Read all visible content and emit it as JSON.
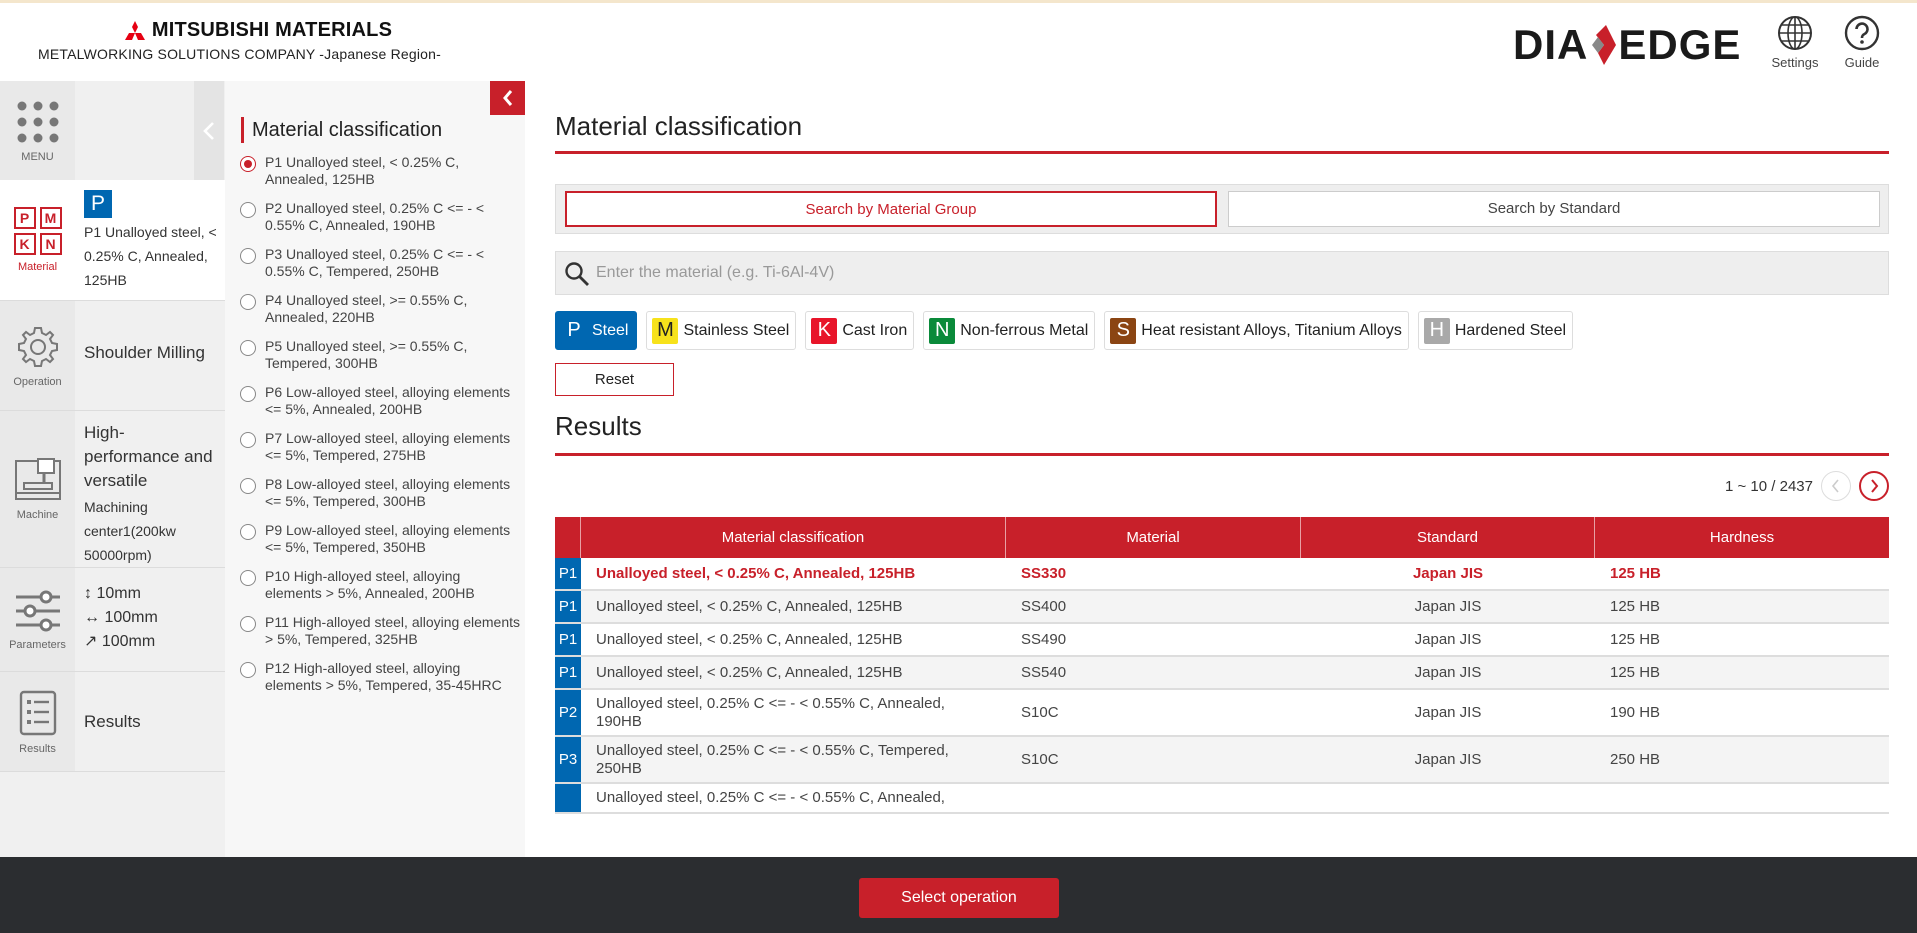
{
  "header": {
    "brand_name": "MITSUBISHI MATERIALS",
    "brand_sub": "METALWORKING SOLUTIONS COMPANY -Japanese Region-",
    "logo_left": "DIA",
    "logo_right": "EDGE",
    "settings_label": "Settings",
    "guide_label": "Guide"
  },
  "sidebar": {
    "menu_label": "MENU",
    "material": {
      "label": "Material",
      "badge": "P",
      "text": "P1 Unalloyed steel, < 0.25% C, Annealed, 125HB"
    },
    "operation": {
      "label": "Operation",
      "text": "Shoulder Milling"
    },
    "machine": {
      "label": "Machine",
      "title": "High-performance and versatile",
      "text": "Machining center1(200kw 50000rpm)"
    },
    "parameters": {
      "label": "Parameters",
      "p1": "↕ 10mm",
      "p2": "↔ 100mm",
      "p3": "↗ 100mm"
    },
    "results": {
      "label": "Results",
      "text": "Results"
    },
    "icon_letters": [
      "P",
      "M",
      "K",
      "N"
    ]
  },
  "material_panel": {
    "title": "Material classification",
    "items": [
      {
        "label": "P1 Unalloyed steel, < 0.25% C, Annealed, 125HB",
        "selected": true
      },
      {
        "label": "P2 Unalloyed steel, 0.25% C <= - < 0.55% C, Annealed, 190HB",
        "selected": false
      },
      {
        "label": "P3 Unalloyed steel, 0.25% C <= - < 0.55% C, Tempered, 250HB",
        "selected": false
      },
      {
        "label": "P4 Unalloyed steel, >= 0.55% C, Annealed, 220HB",
        "selected": false
      },
      {
        "label": "P5 Unalloyed steel, >= 0.55% C, Tempered, 300HB",
        "selected": false
      },
      {
        "label": "P6 Low-alloyed steel, alloying elements <= 5%, Annealed, 200HB",
        "selected": false
      },
      {
        "label": "P7 Low-alloyed steel, alloying elements <= 5%, Tempered, 275HB",
        "selected": false
      },
      {
        "label": "P8 Low-alloyed steel, alloying elements <= 5%, Tempered, 300HB",
        "selected": false
      },
      {
        "label": "P9 Low-alloyed steel, alloying elements <= 5%, Tempered, 350HB",
        "selected": false
      },
      {
        "label": "P10 High-alloyed steel, alloying elements > 5%, Annealed, 200HB",
        "selected": false
      },
      {
        "label": "P11 High-alloyed steel, alloying elements > 5%, Tempered, 325HB",
        "selected": false
      },
      {
        "label": "P12 High-alloyed steel, alloying elements > 5%, Tempered, 35-45HRC",
        "selected": false
      }
    ]
  },
  "main": {
    "title": "Material classification",
    "tab_group": "Search by Material Group",
    "tab_standard": "Search by Standard",
    "search_placeholder": "Enter the material (e.g. Ti-6Al-4V)",
    "chips": [
      {
        "code": "P",
        "label": "Steel",
        "color": "#0067b1",
        "text_color": "#ffffff",
        "active": true
      },
      {
        "code": "M",
        "label": "Stainless Steel",
        "color": "#f7e21b",
        "text_color": "#222222",
        "active": false
      },
      {
        "code": "K",
        "label": "Cast Iron",
        "color": "#e8152a",
        "text_color": "#ffffff",
        "active": false
      },
      {
        "code": "N",
        "label": "Non-ferrous Metal",
        "color": "#0a8a3a",
        "text_color": "#ffffff",
        "active": false
      },
      {
        "code": "S",
        "label": "Heat resistant Alloys, Titanium Alloys",
        "color": "#8b4513",
        "text_color": "#ffffff",
        "active": false
      },
      {
        "code": "H",
        "label": "Hardened Steel",
        "color": "#a9a9a9",
        "text_color": "#ffffff",
        "active": false
      }
    ],
    "reset_label": "Reset",
    "results_title": "Results",
    "pager_text": "1 ~ 10 / 2437",
    "columns": [
      "Material classification",
      "Material",
      "Standard",
      "Hardness"
    ],
    "rows": [
      {
        "group": "P1",
        "classification": "Unalloyed steel, < 0.25% C, Annealed, 125HB",
        "material": "SS330",
        "standard": "Japan JIS",
        "hardness": "125 HB"
      },
      {
        "group": "P1",
        "classification": "Unalloyed steel, < 0.25% C, Annealed, 125HB",
        "material": "SS400",
        "standard": "Japan JIS",
        "hardness": "125 HB"
      },
      {
        "group": "P1",
        "classification": "Unalloyed steel, < 0.25% C, Annealed, 125HB",
        "material": "SS490",
        "standard": "Japan JIS",
        "hardness": "125 HB"
      },
      {
        "group": "P1",
        "classification": "Unalloyed steel, < 0.25% C, Annealed, 125HB",
        "material": "SS540",
        "standard": "Japan JIS",
        "hardness": "125 HB"
      },
      {
        "group": "P2",
        "classification": "Unalloyed steel, 0.25% C <= - < 0.55% C, Annealed, 190HB",
        "material": "S10C",
        "standard": "Japan JIS",
        "hardness": "190 HB"
      },
      {
        "group": "P3",
        "classification": "Unalloyed steel, 0.25% C <= - < 0.55% C, Tempered, 250HB",
        "material": "S10C",
        "standard": "Japan JIS",
        "hardness": "250 HB"
      },
      {
        "group": "",
        "classification": "Unalloyed steel, 0.25% C <= - < 0.55% C, Annealed,",
        "material": "",
        "standard": "",
        "hardness": ""
      }
    ]
  },
  "footer": {
    "select_operation": "Select operation"
  },
  "colors": {
    "accent": "#c8202a",
    "steel_blue": "#0067b1",
    "footer_bg": "#2b2d30"
  }
}
